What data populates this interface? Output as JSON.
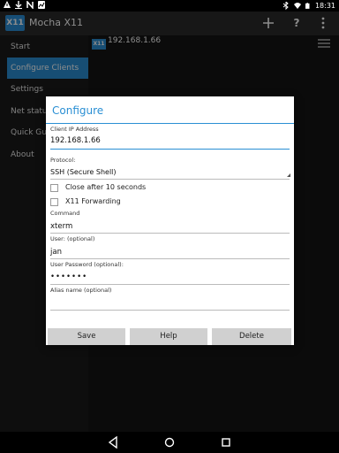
{
  "status_bar": {
    "time": "18:31",
    "icons": [
      "warning-icon",
      "download-icon",
      "n-icon",
      "chart-icon",
      "bluetooth-icon",
      "wifi-icon",
      "battery-icon"
    ]
  },
  "action_bar": {
    "app_logo": "X11",
    "title": "Mocha X11",
    "actions": [
      "add-icon",
      "help-icon",
      "overflow-icon"
    ]
  },
  "sidebar": {
    "items": [
      {
        "label": "Start"
      },
      {
        "label": "Configure Clients"
      },
      {
        "label": "Settings"
      },
      {
        "label": "Net status"
      },
      {
        "label": "Quick Gui"
      },
      {
        "label": "About"
      }
    ]
  },
  "main": {
    "client": {
      "icon_text": "X11",
      "ip": "192.168.1.66"
    }
  },
  "dialog": {
    "title": "Configure",
    "client_ip_label": "Client IP Address",
    "client_ip_value": "192.168.1.66",
    "protocol_label": "Protocol:",
    "protocol_value": "SSH (Secure Shell)",
    "close_label": "Close after 10 seconds",
    "close_checked": false,
    "x11_label": "X11 Forwarding",
    "x11_checked": false,
    "command_label": "Command",
    "command_value": "xterm",
    "user_label": "User: (optional)",
    "user_value": "jan",
    "password_label": "User Password (optional):",
    "password_value": "•••••••",
    "alias_label": "Alias name (optional)",
    "alias_value": "",
    "buttons": {
      "save": "Save",
      "help": "Help",
      "delete": "Delete"
    }
  },
  "colors": {
    "accent": "#2a8fd4",
    "action_bar": "#2b2b2b",
    "dialog_bg": "#ffffff",
    "button_bg": "#d0d0d0"
  }
}
